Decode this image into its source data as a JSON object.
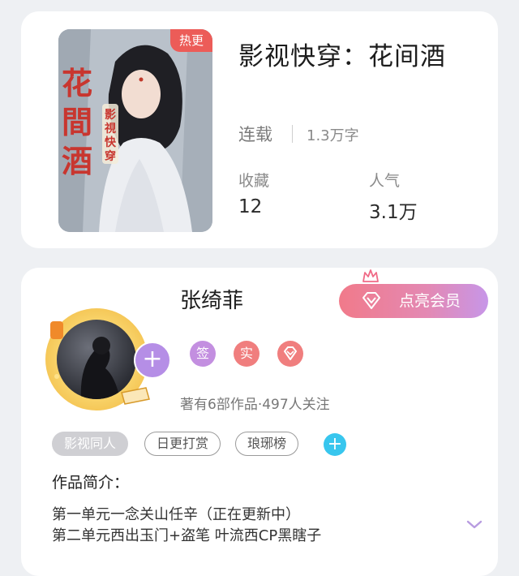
{
  "book": {
    "cover_badge": "热更",
    "cover_text": {
      "title_chars": [
        "花",
        "間",
        "酒"
      ],
      "subtitle_chars": [
        "影",
        "視",
        "快",
        "穿"
      ]
    },
    "title": "影视快穿：花间酒",
    "status": "连载",
    "word_count": "1.3万字",
    "stats": [
      {
        "label": "收藏",
        "value": "12"
      },
      {
        "label": "人气",
        "value": "3.1万"
      }
    ]
  },
  "author": {
    "name": "张绮菲",
    "follow_icon": "plus-icon",
    "vip_button_label": "点亮会员",
    "badges": [
      {
        "text": "签",
        "color": "#c38fe0"
      },
      {
        "text": "实",
        "color": "#f07e7e"
      },
      {
        "text": "",
        "icon": "diamond-icon",
        "color": "#f07e7e"
      }
    ],
    "meta": "著有6部作品·497人关注",
    "tags": [
      "影视同人",
      "日更打赏",
      "琅琊榜"
    ],
    "add_tag_icon": "plus-icon",
    "intro_heading": "作品简介：",
    "intro_lines": [
      "第一单元一念关山任辛（正在更新中）",
      "第二单元西出玉门+盗笔 叶流西CP黑瞎子"
    ],
    "expand_icon": "chevron-down-icon"
  },
  "colors": {
    "hot_badge": "#ec5c58",
    "vip_gradient_start": "#f17a8a",
    "vip_gradient_end": "#c796e8",
    "add_tag": "#38c6ee",
    "follow_plus": "#b58ee6"
  }
}
